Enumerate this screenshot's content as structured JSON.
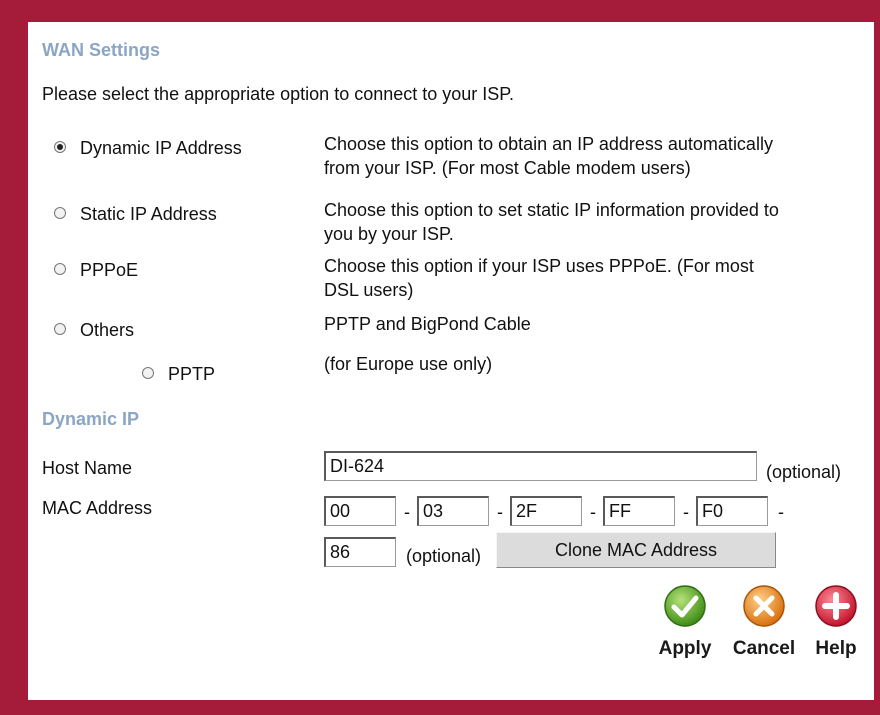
{
  "wan": {
    "title": "WAN Settings",
    "instruction": "Please select the appropriate option to connect to your ISP.",
    "options": [
      {
        "label": "Dynamic IP Address",
        "checked": true,
        "desc_line1": "Choose this option to obtain an IP address automatically",
        "desc_line2": "from your ISP. (For most Cable modem users)"
      },
      {
        "label": "Static IP Address",
        "checked": false,
        "desc_line1": "Choose this option to set static IP information provided to",
        "desc_line2": "you by your ISP."
      },
      {
        "label": "PPPoE",
        "checked": false,
        "desc_line1": "Choose this option if your ISP uses PPPoE. (For most",
        "desc_line2": "DSL users)"
      },
      {
        "label": "Others",
        "checked": false,
        "desc_line1": "PPTP and BigPond Cable",
        "desc_line2": ""
      },
      {
        "label": "PPTP",
        "checked": false,
        "desc_line1": "(for Europe use only)",
        "desc_line2": ""
      }
    ]
  },
  "dynamic": {
    "title": "Dynamic IP",
    "host_label": "Host Name",
    "host_value": "DI-624",
    "host_optional": "(optional)",
    "mac_label": "MAC Address",
    "mac_octets": [
      "00",
      "03",
      "2F",
      "FF",
      "F0",
      "86"
    ],
    "mac_separator": "-",
    "mac_optional": "(optional)",
    "clone_label": "Clone MAC Address"
  },
  "actions": {
    "apply": "Apply",
    "cancel": "Cancel",
    "help": "Help"
  },
  "colors": {
    "frame": "#a51c3a",
    "section_title": "#8aa6c4",
    "apply_icon": "#55a61e",
    "cancel_icon": "#e8891a",
    "help_icon": "#d8233a"
  }
}
